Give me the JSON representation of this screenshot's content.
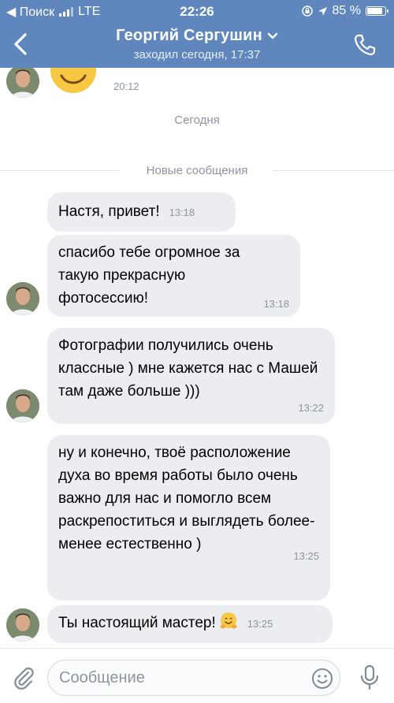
{
  "status_bar": {
    "back_label": "◀ Поиск",
    "network": "LTE",
    "time": "22:26",
    "battery": "85 %",
    "battery_level": 0.85
  },
  "header": {
    "title": "Георгий Сергушин",
    "subtitle": "заходил сегодня, 17:37"
  },
  "chat": {
    "top_time": "20:12",
    "date_separator": "Сегодня",
    "new_messages_label": "Новые сообщения",
    "messages": [
      {
        "text": "Настя, привет!",
        "time": "13:18"
      },
      {
        "text": "спасибо тебе огромное за такую прекрасную фотосессию!",
        "time": "13:18"
      },
      {
        "text": "Фотографии получились очень классные ) мне кажется нас с Машей там даже больше )))",
        "time": "13:22"
      },
      {
        "text": "ну и конечно, твоё расположение духа во время работы было очень важно для нас и помогло всем раскрепоститься и выглядеть более-менее естественно )",
        "time": "13:25"
      },
      {
        "text": "Ты настоящий мастер!",
        "emoji": "hugging-face",
        "time": "13:25"
      }
    ]
  },
  "composer": {
    "placeholder": "Сообщение",
    "value": ""
  },
  "colors": {
    "header_bg": "#5f87bd",
    "bubble_bg": "#ebedf0",
    "meta_text": "#8d949e"
  },
  "icons": {
    "back": "chevron-left-icon",
    "dropdown": "chevron-down-icon",
    "call": "phone-icon",
    "attach": "paperclip-icon",
    "sticker": "smiley-icon",
    "mic": "microphone-icon"
  }
}
